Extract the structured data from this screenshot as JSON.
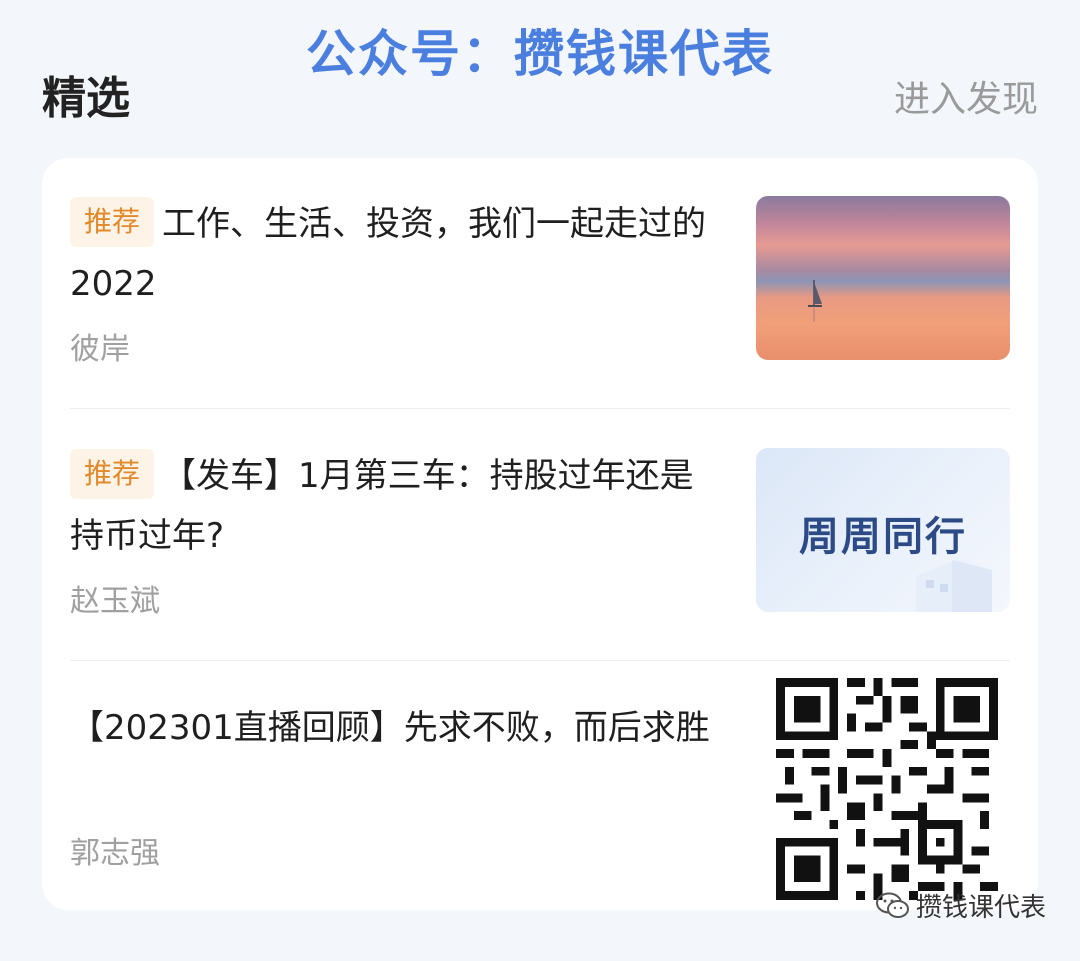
{
  "watermark_top": "公众号：攒钱课代表",
  "section": {
    "title": "精选",
    "more_label": "进入发现"
  },
  "articles": [
    {
      "tag": "推荐",
      "title": "工作、生活、投资，我们一起走过的2022",
      "author": "彼岸",
      "thumbnail": "sunset-sailboat-image"
    },
    {
      "tag": "推荐",
      "title": "【发车】1月第三车：持股过年还是持币过年?",
      "author": "赵玉斌",
      "thumbnail_label": "周周同行"
    },
    {
      "tag": "",
      "title": "【202301直播回顾】先求不败，而后求胜",
      "author": "郭志强",
      "thumbnail": "qr-code"
    }
  ],
  "watermark_bottom": "攒钱课代表",
  "colors": {
    "watermark_blue": "#4a7fe0",
    "tag_bg": "#fdf3e6",
    "tag_text": "#e28a2b",
    "author_gray": "#a0a0a0",
    "more_gray": "#9a9a9a"
  }
}
